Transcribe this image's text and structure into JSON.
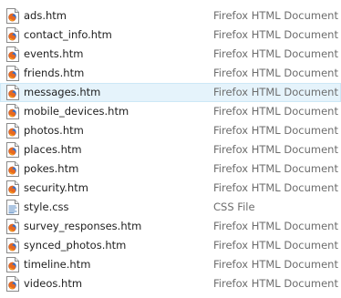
{
  "files": [
    {
      "name": "ads.htm",
      "type": "Firefox HTML Document",
      "icon": "firefox-html-file-icon",
      "hovered": false
    },
    {
      "name": "contact_info.htm",
      "type": "Firefox HTML Document",
      "icon": "firefox-html-file-icon",
      "hovered": false
    },
    {
      "name": "events.htm",
      "type": "Firefox HTML Document",
      "icon": "firefox-html-file-icon",
      "hovered": false
    },
    {
      "name": "friends.htm",
      "type": "Firefox HTML Document",
      "icon": "firefox-html-file-icon",
      "hovered": false
    },
    {
      "name": "messages.htm",
      "type": "Firefox HTML Document",
      "icon": "firefox-html-file-icon",
      "hovered": true
    },
    {
      "name": "mobile_devices.htm",
      "type": "Firefox HTML Document",
      "icon": "firefox-html-file-icon",
      "hovered": false
    },
    {
      "name": "photos.htm",
      "type": "Firefox HTML Document",
      "icon": "firefox-html-file-icon",
      "hovered": false
    },
    {
      "name": "places.htm",
      "type": "Firefox HTML Document",
      "icon": "firefox-html-file-icon",
      "hovered": false
    },
    {
      "name": "pokes.htm",
      "type": "Firefox HTML Document",
      "icon": "firefox-html-file-icon",
      "hovered": false
    },
    {
      "name": "security.htm",
      "type": "Firefox HTML Document",
      "icon": "firefox-html-file-icon",
      "hovered": false
    },
    {
      "name": "style.css",
      "type": "CSS File",
      "icon": "css-file-icon",
      "hovered": false
    },
    {
      "name": "survey_responses.htm",
      "type": "Firefox HTML Document",
      "icon": "firefox-html-file-icon",
      "hovered": false
    },
    {
      "name": "synced_photos.htm",
      "type": "Firefox HTML Document",
      "icon": "firefox-html-file-icon",
      "hovered": false
    },
    {
      "name": "timeline.htm",
      "type": "Firefox HTML Document",
      "icon": "firefox-html-file-icon",
      "hovered": false
    },
    {
      "name": "videos.htm",
      "type": "Firefox HTML Document",
      "icon": "firefox-html-file-icon",
      "hovered": false
    }
  ],
  "colors": {
    "hover_background": "#e5f3fb",
    "hover_border": "#cde8f7",
    "name_text": "#1e1e1e",
    "type_text": "#6d6d6d"
  }
}
